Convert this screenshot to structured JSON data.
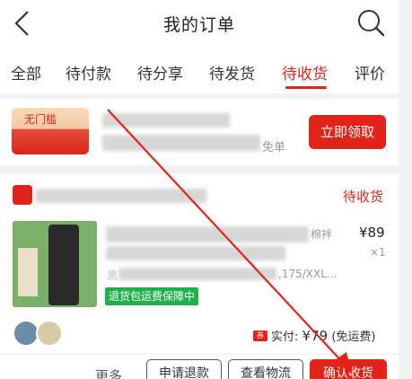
{
  "header": {
    "title": "我的订单",
    "back_icon": "chevron-left-icon",
    "search_icon": "search-icon"
  },
  "tabs": [
    {
      "label": "全部",
      "active": false
    },
    {
      "label": "待付款",
      "active": false
    },
    {
      "label": "待分享",
      "active": false
    },
    {
      "label": "待发货",
      "active": false
    },
    {
      "label": "待收货",
      "active": true
    },
    {
      "label": "评价",
      "active": false
    }
  ],
  "coupon": {
    "ticket_text": "无门槛",
    "free_text": "免单",
    "claim_label": "立即领取"
  },
  "order": {
    "status": "待收货",
    "title_tail": "棉袢",
    "spec_head": "黑",
    "spec_tail": ",175/XXL...",
    "price": "¥89",
    "quantity": "×1",
    "return_badge": "退货包运费保障中",
    "coupon_mark": "券",
    "paid_label": "实付:",
    "paid_amount": "¥79",
    "shipping_note": "(免运费)",
    "more_label": "更多",
    "refund_label": "申请退款",
    "logistics_label": "查看物流",
    "confirm_label": "确认收货"
  },
  "colors": {
    "accent": "#e2231a",
    "badge_green": "#21b04b"
  }
}
